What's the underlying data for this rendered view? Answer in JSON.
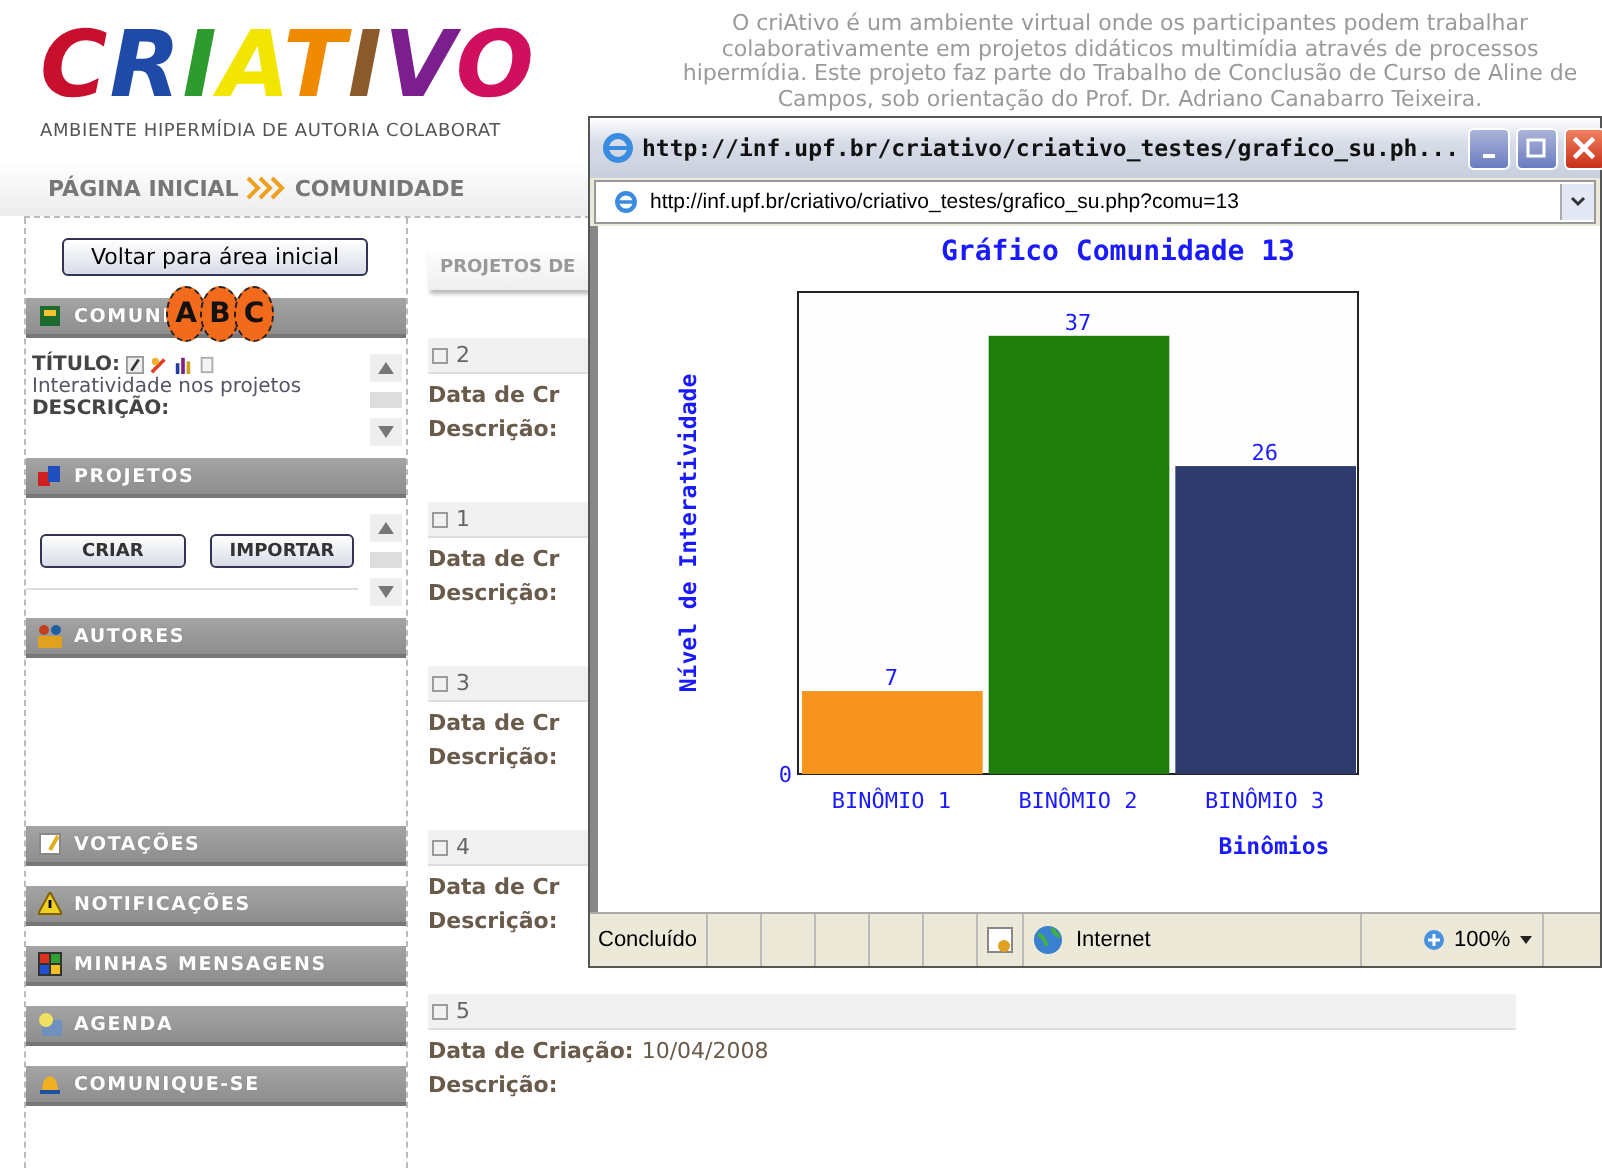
{
  "header": {
    "logo": "CRIATIVO",
    "tagline": "AMBIENTE HIPERMÍDIA DE AUTORIA COLABORAT",
    "about": "O criAtivo é um ambiente virtual onde os participantes podem trabalhar colaborativamente em projetos didáticos multimídia através de processos hipermídia. Este projeto faz parte do Trabalho de Conclusão de Curso de Aline de Campos, sob orientação do Prof. Dr. Adriano Canabarro Teixeira."
  },
  "breadcrumb": [
    {
      "label": "PÁGINA INICIAL"
    },
    {
      "label": "COMUNIDADE"
    }
  ],
  "sidebar": {
    "back_button": "Voltar para área inicial",
    "community": {
      "header": "COMUNI",
      "badges": [
        "A",
        "B",
        "C"
      ],
      "title_label": "TÍTULO:",
      "title_value": "Interatividade nos projetos",
      "description_label": "DESCRIÇÃO:"
    },
    "projects": {
      "header": "PROJETOS",
      "buttons": [
        "CRIAR",
        "IMPORTAR"
      ]
    },
    "authors": {
      "header": "AUTORES"
    },
    "menu": [
      {
        "label": "VOTAÇÕES"
      },
      {
        "label": "NOTIFICAÇÕES"
      },
      {
        "label": "MINHAS MENSAGENS"
      },
      {
        "label": "AGENDA"
      },
      {
        "label": "COMUNIQUE-SE"
      }
    ]
  },
  "main": {
    "tab": "PROJETOS DE",
    "projects": [
      {
        "number": "2",
        "created_label": "Data de Cr",
        "description_label": "Descrição:"
      },
      {
        "number": "1",
        "created_label": "Data de Cr",
        "description_label": "Descrição:"
      },
      {
        "number": "3",
        "created_label": "Data de Cr",
        "description_label": "Descrição:"
      },
      {
        "number": "4",
        "created_label": "Data de Cr",
        "description_label": "Descrição:"
      },
      {
        "number": "5",
        "created_label": "Data de Criação:",
        "created_value": "10/04/2008",
        "description_label": "Descrição:"
      }
    ]
  },
  "popup": {
    "title": "http://inf.upf.br/criativo/criativo_testes/grafico_su.ph...",
    "address": "http://inf.upf.br/criativo/criativo_testes/grafico_su.php?comu=13",
    "chart_data": {
      "type": "bar",
      "title": "Gráfico Comunidade 13",
      "xlabel": "Binômios",
      "ylabel": "Nível de Interatividade",
      "categories": [
        "BINÔMIO 1",
        "BINÔMIO 2",
        "BINÔMIO 3"
      ],
      "values": [
        7,
        37,
        26
      ],
      "annotations": [
        {
          "text": "0"
        }
      ],
      "data_labels": true
    },
    "status": {
      "text": "Concluído",
      "zone": "Internet",
      "zoom": "100%"
    }
  }
}
